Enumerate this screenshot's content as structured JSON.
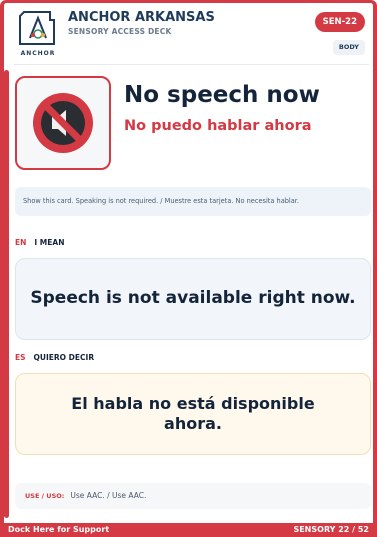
{
  "header": {
    "org_name": "ANCHOR ARKANSAS",
    "deck_name": "SENSORY ACCESS DECK",
    "logo_text": "ANCHOR",
    "card_code": "SEN-22",
    "category": "BODY"
  },
  "hero": {
    "icon": "muted-speaker-icon",
    "title_en": "No speech now",
    "title_es": "No puedo hablar ahora"
  },
  "instruction": "Show this card. Speaking is not required. / Muestre esta tarjeta. No necesita hablar.",
  "sections": {
    "en": {
      "code": "EN",
      "heading": "I MEAN",
      "text": "Speech is not available right now."
    },
    "es": {
      "code": "ES",
      "heading": "QUIERO DECIR",
      "text": "El habla no está disponible ahora."
    }
  },
  "use": {
    "label": "USE / USO:",
    "text": "Use AAC. / Use AAC."
  },
  "footer": {
    "left": "Dock Here for Support",
    "right": "SENSORY 22 / 52"
  },
  "colors": {
    "accent": "#d33a44",
    "navy": "#14243a",
    "en_card": "#f2f6fb",
    "es_card": "#fff8ec"
  }
}
